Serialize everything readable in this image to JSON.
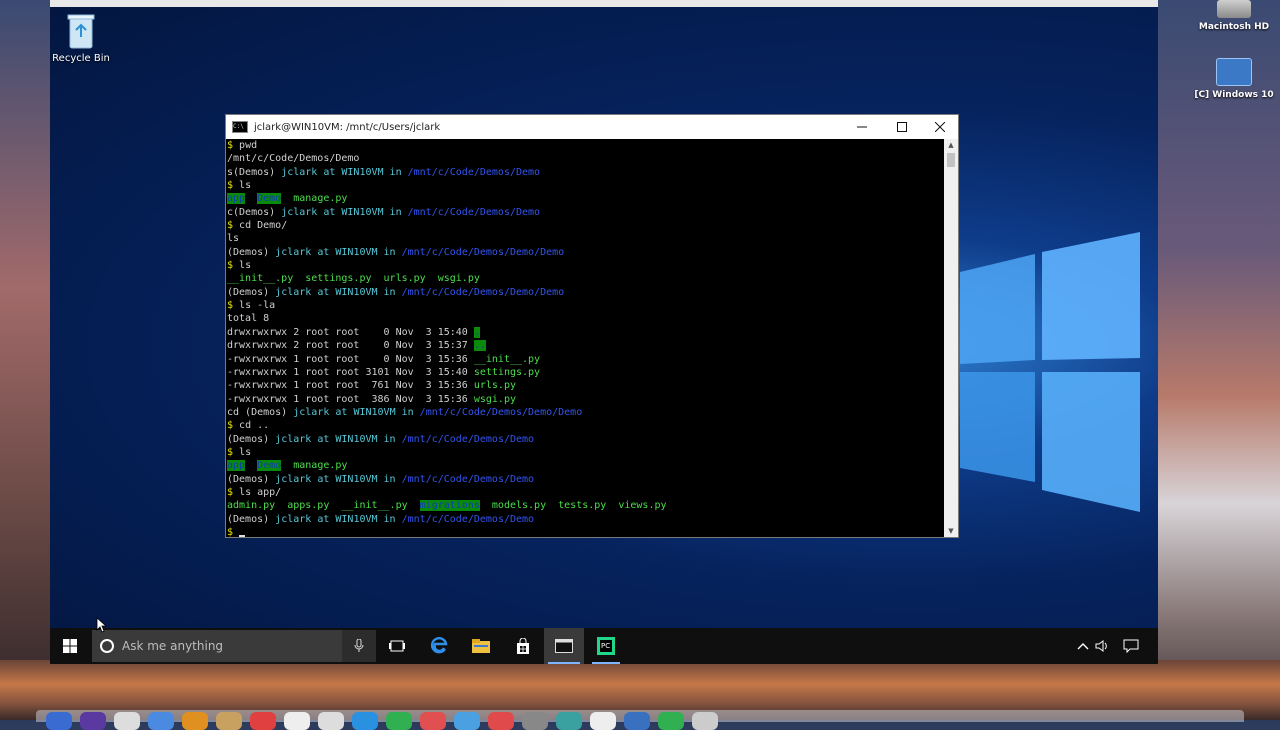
{
  "mac_desktop": {
    "icons": [
      {
        "label": "Macintosh HD"
      },
      {
        "label": "[C] Windows 10"
      }
    ]
  },
  "vm_desktop": {
    "recycle_bin_label": "Recycle Bin"
  },
  "terminal": {
    "title": "jclark@WIN10VM: /mnt/c/Users/jclark",
    "lines": [
      [
        {
          "t": "$ ",
          "c": "y"
        },
        {
          "t": "pwd",
          "c": "w"
        }
      ],
      [
        {
          "t": "/mnt/c/Code/Demos/Demo",
          "c": "w"
        }
      ],
      [
        {
          "t": "s(Demos) ",
          "c": "w"
        },
        {
          "t": "jclark at WIN10VM in ",
          "c": "c"
        },
        {
          "t": "/mnt/c/Code/Demos/Demo",
          "c": "b"
        }
      ],
      [
        {
          "t": "$ ",
          "c": "y"
        },
        {
          "t": "ls",
          "c": "w"
        }
      ],
      [
        {
          "t": "app",
          "c": "hl"
        },
        {
          "t": "  ",
          "c": "w"
        },
        {
          "t": "Demo",
          "c": "hl"
        },
        {
          "t": "  manage.py",
          "c": "g"
        }
      ],
      [
        {
          "t": "c(Demos) ",
          "c": "w"
        },
        {
          "t": "jclark at WIN10VM in ",
          "c": "c"
        },
        {
          "t": "/mnt/c/Code/Demos/Demo",
          "c": "b"
        }
      ],
      [
        {
          "t": "$ ",
          "c": "y"
        },
        {
          "t": "cd Demo/",
          "c": "w"
        }
      ],
      [
        {
          "t": "ls",
          "c": "w"
        }
      ],
      [
        {
          "t": "(Demos) ",
          "c": "w"
        },
        {
          "t": "jclark at WIN10VM in ",
          "c": "c"
        },
        {
          "t": "/mnt/c/Code/Demos/Demo/Demo",
          "c": "b"
        }
      ],
      [
        {
          "t": "$ ",
          "c": "y"
        },
        {
          "t": "ls",
          "c": "w"
        }
      ],
      [
        {
          "t": "__init__.py  settings.py  urls.py  wsgi.py",
          "c": "g"
        }
      ],
      [
        {
          "t": "(Demos) ",
          "c": "w"
        },
        {
          "t": "jclark at WIN10VM in ",
          "c": "c"
        },
        {
          "t": "/mnt/c/Code/Demos/Demo/Demo",
          "c": "b"
        }
      ],
      [
        {
          "t": "$ ",
          "c": "y"
        },
        {
          "t": "ls -la",
          "c": "w"
        }
      ],
      [
        {
          "t": "total 8",
          "c": "w"
        }
      ],
      [
        {
          "t": "drwxrwxrwx 2 root root    0 Nov  3 15:40 ",
          "c": "w"
        },
        {
          "t": ".",
          "c": "hl"
        }
      ],
      [
        {
          "t": "drwxrwxrwx 2 root root    0 Nov  3 15:37 ",
          "c": "w"
        },
        {
          "t": "..",
          "c": "hl"
        }
      ],
      [
        {
          "t": "-rwxrwxrwx 1 root root    0 Nov  3 15:36 ",
          "c": "w"
        },
        {
          "t": "__init__.py",
          "c": "g"
        }
      ],
      [
        {
          "t": "-rwxrwxrwx 1 root root 3101 Nov  3 15:40 ",
          "c": "w"
        },
        {
          "t": "settings.py",
          "c": "g"
        }
      ],
      [
        {
          "t": "-rwxrwxrwx 1 root root  761 Nov  3 15:36 ",
          "c": "w"
        },
        {
          "t": "urls.py",
          "c": "g"
        }
      ],
      [
        {
          "t": "-rwxrwxrwx 1 root root  386 Nov  3 15:36 ",
          "c": "w"
        },
        {
          "t": "wsgi.py",
          "c": "g"
        }
      ],
      [
        {
          "t": "cd (Demos) ",
          "c": "w"
        },
        {
          "t": "jclark at WIN10VM in ",
          "c": "c"
        },
        {
          "t": "/mnt/c/Code/Demos/Demo/Demo",
          "c": "b"
        }
      ],
      [
        {
          "t": "$ ",
          "c": "y"
        },
        {
          "t": "cd ..",
          "c": "w"
        }
      ],
      [
        {
          "t": "(Demos) ",
          "c": "w"
        },
        {
          "t": "jclark at WIN10VM in ",
          "c": "c"
        },
        {
          "t": "/mnt/c/Code/Demos/Demo",
          "c": "b"
        }
      ],
      [
        {
          "t": "$ ",
          "c": "y"
        },
        {
          "t": "ls",
          "c": "w"
        }
      ],
      [
        {
          "t": "app",
          "c": "hl"
        },
        {
          "t": "  ",
          "c": "w"
        },
        {
          "t": "Demo",
          "c": "hl"
        },
        {
          "t": "  manage.py",
          "c": "g"
        }
      ],
      [
        {
          "t": "(Demos) ",
          "c": "w"
        },
        {
          "t": "jclark at WIN10VM in ",
          "c": "c"
        },
        {
          "t": "/mnt/c/Code/Demos/Demo",
          "c": "b"
        }
      ],
      [
        {
          "t": "$ ",
          "c": "y"
        },
        {
          "t": "ls app/",
          "c": "w"
        }
      ],
      [
        {
          "t": "admin.py  apps.py  __init__.py  ",
          "c": "g"
        },
        {
          "t": "migrations",
          "c": "hl"
        },
        {
          "t": "  models.py  tests.py  views.py",
          "c": "g"
        }
      ],
      [
        {
          "t": "(Demos) ",
          "c": "w"
        },
        {
          "t": "jclark at WIN10VM in ",
          "c": "c"
        },
        {
          "t": "/mnt/c/Code/Demos/Demo",
          "c": "b"
        }
      ],
      [
        {
          "t": "$ ",
          "c": "y"
        },
        {
          "t": "",
          "c": "cursor"
        }
      ]
    ]
  },
  "taskbar": {
    "search_placeholder": "Ask me anything"
  },
  "colors": {
    "prompt": "#e6e600",
    "path": "#3355ee",
    "user": "#56c8d8",
    "file": "#4cde4c",
    "dir_highlight": "#0a8a0a"
  }
}
